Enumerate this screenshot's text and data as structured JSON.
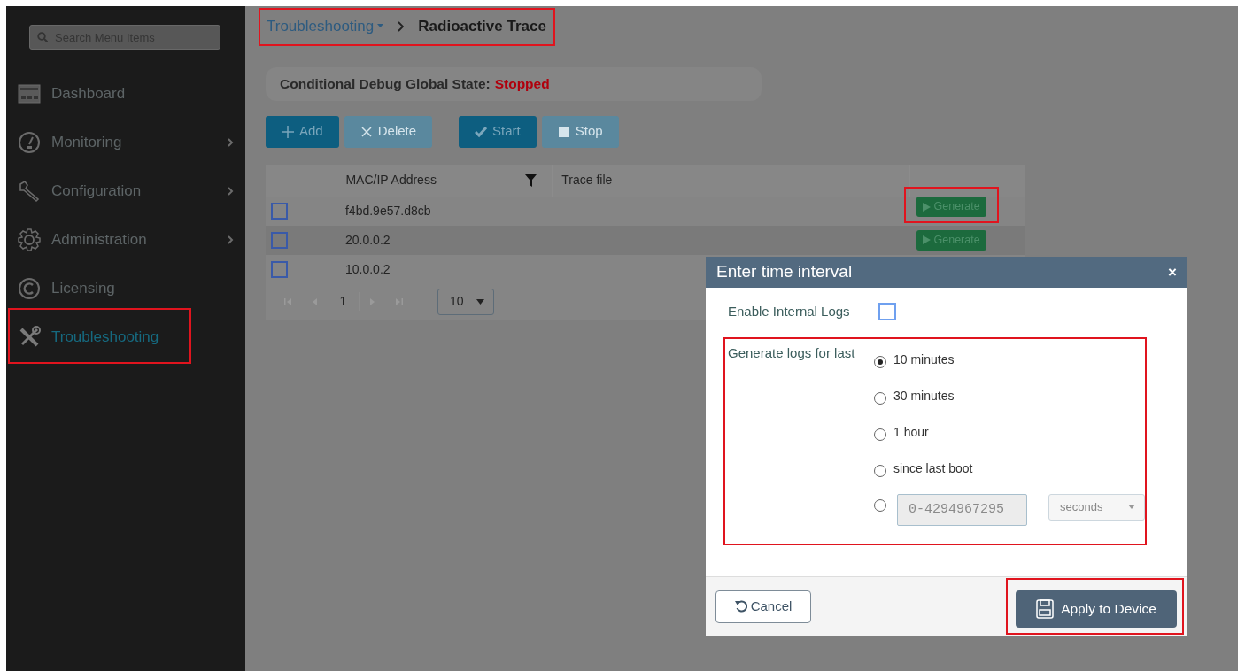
{
  "sidebar": {
    "search": {
      "placeholder": "Search Menu Items"
    },
    "items": [
      {
        "label": "Dashboard",
        "has_submenu": false,
        "selected": false,
        "highlighted": false
      },
      {
        "label": "Monitoring",
        "has_submenu": true,
        "selected": false,
        "highlighted": false
      },
      {
        "label": "Configuration",
        "has_submenu": true,
        "selected": false,
        "highlighted": false
      },
      {
        "label": "Administration",
        "has_submenu": true,
        "selected": false,
        "highlighted": false
      },
      {
        "label": "Licensing",
        "has_submenu": false,
        "selected": false,
        "highlighted": false
      },
      {
        "label": "Troubleshooting",
        "has_submenu": false,
        "selected": true,
        "highlighted": true
      }
    ]
  },
  "breadcrumb": {
    "parent": "Troubleshooting",
    "current": "Radioactive Trace",
    "highlighted": true
  },
  "status": {
    "label": "Conditional Debug Global State:",
    "value": "Stopped"
  },
  "toolbar": [
    {
      "label": "Add",
      "disabled": false
    },
    {
      "label": "Delete",
      "disabled": true
    },
    {
      "label": "Start",
      "disabled": false
    },
    {
      "label": "Stop",
      "disabled": true
    }
  ],
  "table": {
    "columns": [
      "MAC/IP Address",
      "Trace file"
    ],
    "rows": [
      {
        "address": "f4bd.9e57.d8cb",
        "checked": false,
        "action": "Generate",
        "highlighted": true
      },
      {
        "address": "20.0.0.2",
        "checked": false,
        "action": "Generate",
        "highlighted": false
      },
      {
        "address": "10.0.0.2",
        "checked": false
      }
    ],
    "pager": {
      "page": "1",
      "page_size": "10"
    }
  },
  "dialog": {
    "title": "Enter time interval",
    "close": "×",
    "internal_logs": {
      "label": "Enable Internal Logs",
      "checked": false
    },
    "interval": {
      "label": "Generate logs for last",
      "highlighted": true,
      "options": [
        {
          "kind": "preset",
          "label": "10 minutes",
          "selected": true
        },
        {
          "kind": "preset",
          "label": "30 minutes",
          "selected": false
        },
        {
          "kind": "preset",
          "label": "1 hour",
          "selected": false
        },
        {
          "kind": "preset",
          "label": "since last boot",
          "selected": false
        },
        {
          "kind": "custom",
          "placeholder": "0-4294967295",
          "unit": "seconds",
          "selected": false
        }
      ]
    },
    "buttons": [
      {
        "kind": "cancel",
        "label": "Cancel",
        "highlighted": false
      },
      {
        "kind": "apply",
        "label": "Apply to Device",
        "highlighted": true
      }
    ]
  }
}
